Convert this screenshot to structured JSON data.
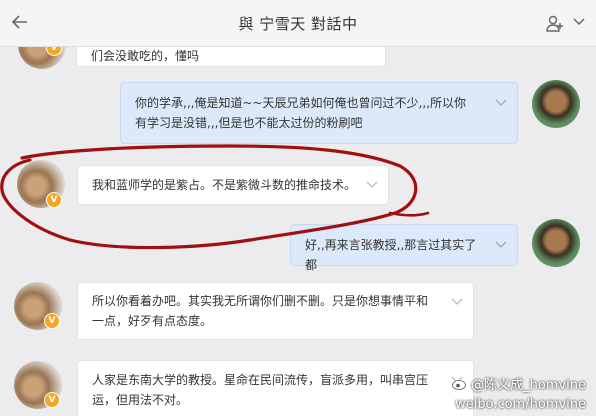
{
  "header": {
    "title": "與 宁雪天 對話中"
  },
  "messages": [
    {
      "side": "in",
      "text": "们会没敢吃的，懂吗"
    },
    {
      "side": "out",
      "text": "你的学承,,,俺是知道~~天辰兄弟如何俺也曾问过不少,,,所以你有学习是没错,,,但是也不能太过份的粉刷吧"
    },
    {
      "side": "in",
      "text": "我和蓝师学的是紫占。不是紫微斗数的推命技术。"
    },
    {
      "side": "out",
      "text": "好,,再来言张教授,,那言过其实了都"
    },
    {
      "side": "in",
      "text": "所以你看着办吧。其实我无所谓你们删不删。只是你想事情平和一点，好歹有点态度。"
    },
    {
      "side": "in",
      "text": "人家是东南大学的教授。星命在民间流传，盲派多用，叫串宫压运，但用法不对。"
    }
  ],
  "badge_glyph": "V",
  "watermark": {
    "line1": "@陈义成_homvine",
    "line2": "weibo.com/homvine"
  },
  "colors": {
    "annotation": "#a01010",
    "badge": "#f5a623",
    "outgoing_bubble": "#dbe9fa"
  }
}
